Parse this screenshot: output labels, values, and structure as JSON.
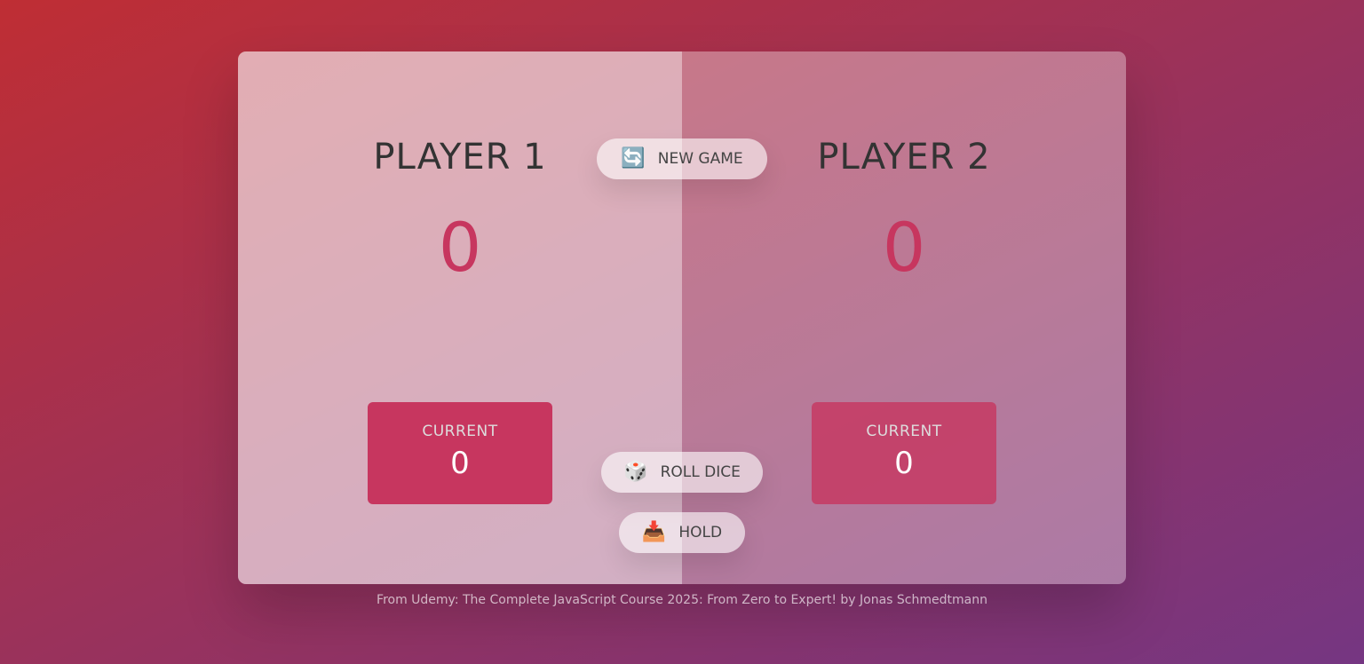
{
  "players": [
    {
      "name": "PLAYER 1",
      "score": "0",
      "current_label": "CURRENT",
      "current_score": "0"
    },
    {
      "name": "PLAYER 2",
      "score": "0",
      "current_label": "CURRENT",
      "current_score": "0"
    }
  ],
  "buttons": {
    "new_game": {
      "icon": "🔄",
      "label": "NEW GAME"
    },
    "roll_dice": {
      "icon": "🎲",
      "label": "ROLL DICE"
    },
    "hold": {
      "icon": "📥",
      "label": "HOLD"
    }
  },
  "footer": "From Udemy: The Complete JavaScript Course 2025: From Zero to Expert! by Jonas Schmedtmann",
  "colors": {
    "accent": "#c7365f",
    "bg_from": "#bf2e34",
    "bg_to": "#753682"
  }
}
